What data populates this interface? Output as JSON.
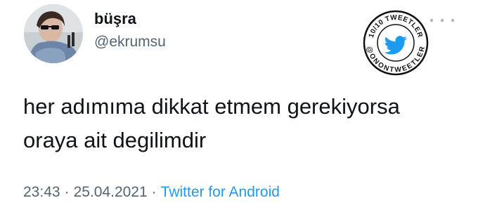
{
  "author": {
    "display_name": "büşra",
    "handle": "@ekrumsu"
  },
  "badge": {
    "top_text": "10/10 TWEETLER",
    "bottom_text": "@ONONTWEETLER",
    "icon": "twitter-bird-icon"
  },
  "tweet": {
    "lines": [
      "her adımıma dikkat etmem gerekiyorsa",
      "oraya ait degilimdir"
    ]
  },
  "meta": {
    "time": "23:43",
    "separator": "·",
    "date": "25.04.2021",
    "source": "Twitter for Android"
  },
  "colors": {
    "text": "#0f1419",
    "secondary": "#536471",
    "link": "#1d9bf0"
  }
}
